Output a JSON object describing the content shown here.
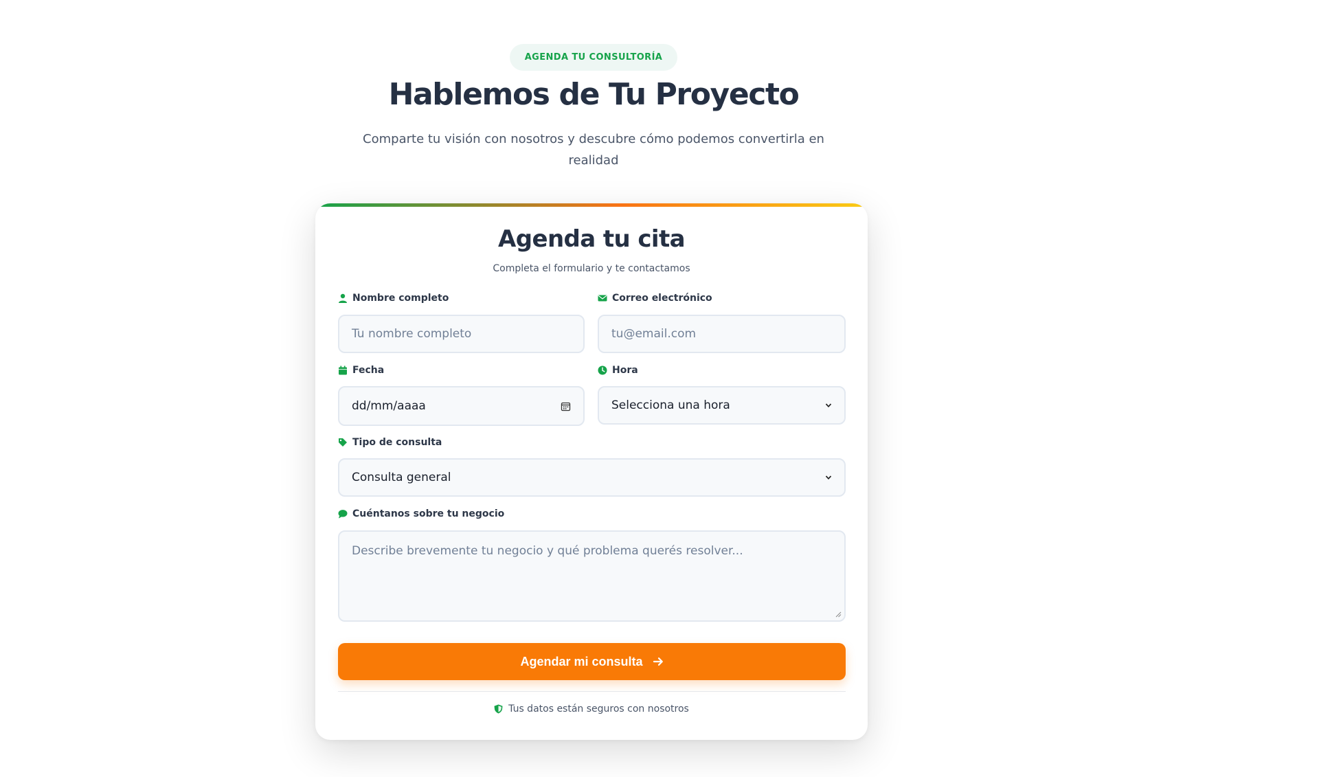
{
  "header": {
    "badge": "AGENDA TU CONSULTORÍA",
    "title": "Hablemos de Tu Proyecto",
    "subtitle": "Comparte tu visión con nosotros y descubre cómo podemos convertirla en realidad"
  },
  "form": {
    "title": "Agenda tu cita",
    "subtitle": "Completa el formulario y te contactamos",
    "fields": {
      "name": {
        "label": "Nombre completo",
        "placeholder": "Tu nombre completo",
        "icon": "user-icon"
      },
      "email": {
        "label": "Correo electrónico",
        "placeholder": "tu@email.com",
        "icon": "envelope-icon"
      },
      "date": {
        "label": "Fecha",
        "placeholder": "dd/mm/aaaa",
        "icon": "calendar-icon"
      },
      "time": {
        "label": "Hora",
        "value": "Selecciona una hora",
        "icon": "clock-icon"
      },
      "type": {
        "label": "Tipo de consulta",
        "value": "Consulta general",
        "icon": "tag-icon"
      },
      "message": {
        "label": "Cuéntanos sobre tu negocio",
        "placeholder": "Describe brevemente tu negocio y qué problema querés resolver...",
        "icon": "chat-icon"
      }
    },
    "submit_label": "Agendar mi consulta",
    "secure_note": "Tus datos están seguros con nosotros"
  },
  "colors": {
    "accent_green": "#16a34a",
    "accent_orange": "#f97a06",
    "heading": "#253043"
  }
}
